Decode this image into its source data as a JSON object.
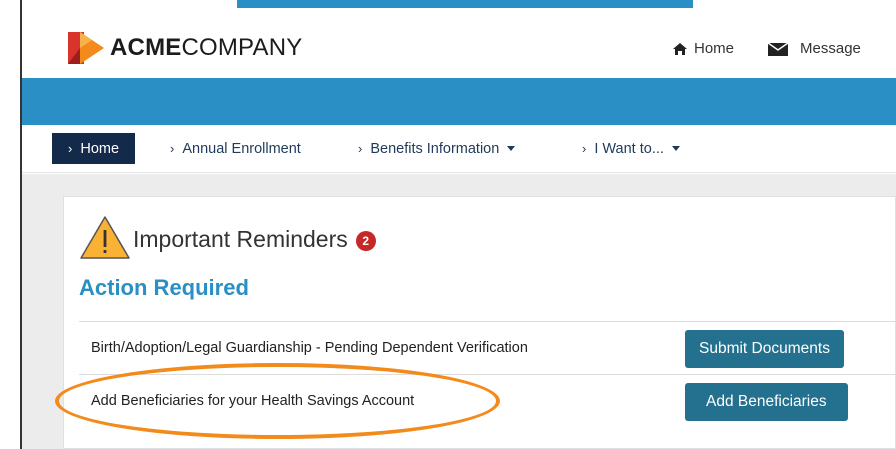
{
  "brand": {
    "name_bold": "ACME",
    "name_rest": "COMPANY",
    "colors": {
      "orange": "#f38b1c",
      "red": "#d9342b",
      "navy": "#142a4a"
    }
  },
  "top_links": [
    {
      "label": "Home",
      "icon": "home-icon"
    },
    {
      "label": "Message",
      "icon": "envelope-icon"
    }
  ],
  "nav": {
    "items": [
      {
        "label": "Home",
        "active": true
      },
      {
        "label": "Annual Enrollment"
      },
      {
        "label": "Benefits Information",
        "has_dropdown": true
      },
      {
        "label": "I Want to...",
        "has_dropdown": true
      }
    ]
  },
  "reminders": {
    "title": "Important Reminders",
    "count": "2",
    "icon": "warning-icon"
  },
  "action": {
    "title": "Action Required",
    "rows": [
      {
        "text": "Birth/Adoption/Legal Guardianship - Pending Dependent Verification",
        "button": "Submit Documents"
      },
      {
        "text": "Add Beneficiaries for your Health Savings Account",
        "button": "Add Beneficiaries"
      }
    ]
  },
  "colors": {
    "accent_blue": "#2a8fc4",
    "button_teal": "#23708f",
    "badge_red": "#c62828",
    "highlight_orange": "#f38b1c"
  }
}
